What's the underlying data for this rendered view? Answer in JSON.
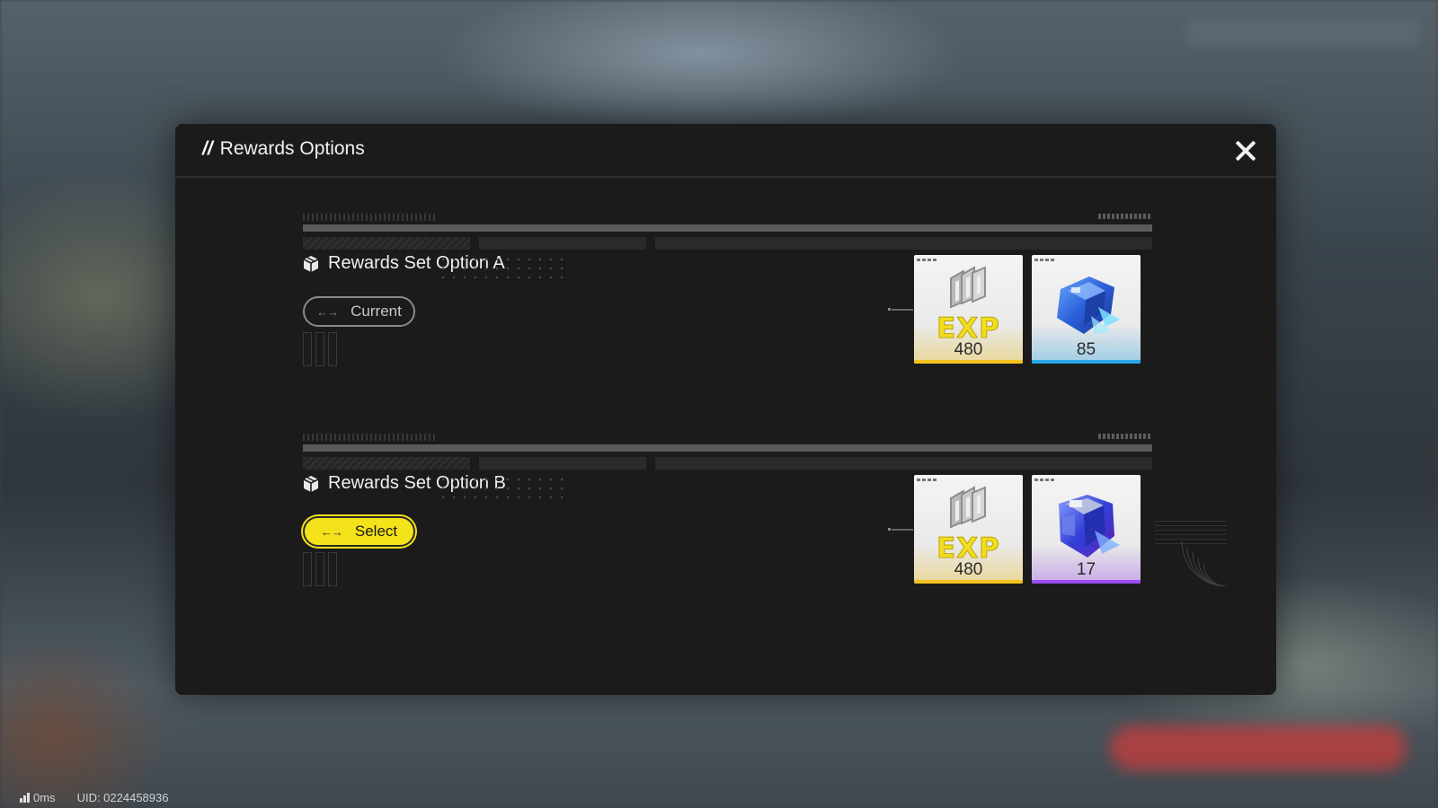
{
  "modal": {
    "title": "Rewards Options",
    "title_prefix": "//"
  },
  "options": [
    {
      "title": "Rewards Set Option A",
      "button_label": "Current",
      "button_state": "current",
      "rewards": [
        {
          "icon": "exp-icon",
          "label": "EXP",
          "count": "480",
          "rarity_color": "#f2c21e"
        },
        {
          "icon": "blue-chip-icon",
          "count": "85",
          "rarity_color": "#29a6e8"
        }
      ]
    },
    {
      "title": "Rewards Set Option B",
      "button_label": "Select",
      "button_state": "selectable",
      "rewards": [
        {
          "icon": "exp-icon",
          "label": "EXP",
          "count": "480",
          "rarity_color": "#f2c21e"
        },
        {
          "icon": "purple-chip-icon",
          "count": "17",
          "rarity_color": "#9a4ef0"
        }
      ]
    }
  ],
  "footer": {
    "ping": "0ms",
    "uid": "UID: 0224458936"
  },
  "colors": {
    "accent_yellow": "#f4e21a",
    "modal_bg": "#1b1b1b"
  }
}
